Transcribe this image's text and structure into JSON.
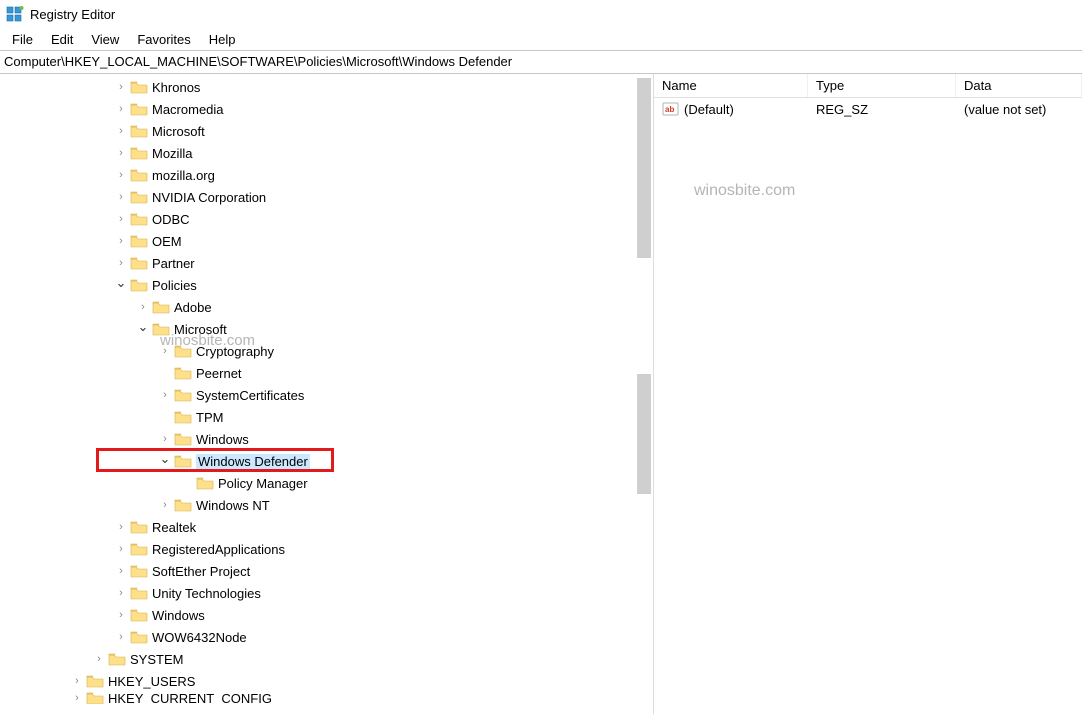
{
  "window": {
    "title": "Registry Editor"
  },
  "menu": {
    "items": [
      "File",
      "Edit",
      "View",
      "Favorites",
      "Help"
    ]
  },
  "address": {
    "path": "Computer\\HKEY_LOCAL_MACHINE\\SOFTWARE\\Policies\\Microsoft\\Windows Defender"
  },
  "list": {
    "columns": [
      "Name",
      "Type",
      "Data"
    ],
    "rows": [
      {
        "name": "(Default)",
        "type": "REG_SZ",
        "data": "(value not set)"
      }
    ]
  },
  "watermark": {
    "text": "winosbite.com"
  },
  "tree": [
    {
      "d": 3,
      "chev": "r",
      "label": "Khronos"
    },
    {
      "d": 3,
      "chev": "r",
      "label": "Macromedia"
    },
    {
      "d": 3,
      "chev": "r",
      "label": "Microsoft"
    },
    {
      "d": 3,
      "chev": "r",
      "label": "Mozilla"
    },
    {
      "d": 3,
      "chev": "r",
      "label": "mozilla.org"
    },
    {
      "d": 3,
      "chev": "r",
      "label": "NVIDIA Corporation"
    },
    {
      "d": 3,
      "chev": "r",
      "label": "ODBC"
    },
    {
      "d": 3,
      "chev": "r",
      "label": "OEM"
    },
    {
      "d": 3,
      "chev": "r",
      "label": "Partner"
    },
    {
      "d": 3,
      "chev": "d",
      "label": "Policies"
    },
    {
      "d": 4,
      "chev": "r",
      "label": "Adobe"
    },
    {
      "d": 4,
      "chev": "d",
      "label": "Microsoft"
    },
    {
      "d": 5,
      "chev": "r",
      "label": "Cryptography"
    },
    {
      "d": 5,
      "chev": "",
      "label": "Peernet"
    },
    {
      "d": 5,
      "chev": "r",
      "label": "SystemCertificates"
    },
    {
      "d": 5,
      "chev": "",
      "label": "TPM"
    },
    {
      "d": 5,
      "chev": "r",
      "label": "Windows"
    },
    {
      "d": 5,
      "chev": "d",
      "label": "Windows Defender",
      "selected": true
    },
    {
      "d": 6,
      "chev": "",
      "label": "Policy Manager"
    },
    {
      "d": 5,
      "chev": "r",
      "label": "Windows NT"
    },
    {
      "d": 3,
      "chev": "r",
      "label": "Realtek"
    },
    {
      "d": 3,
      "chev": "r",
      "label": "RegisteredApplications"
    },
    {
      "d": 3,
      "chev": "r",
      "label": "SoftEther Project"
    },
    {
      "d": 3,
      "chev": "r",
      "label": "Unity Technologies"
    },
    {
      "d": 3,
      "chev": "r",
      "label": "Windows"
    },
    {
      "d": 3,
      "chev": "r",
      "label": "WOW6432Node"
    },
    {
      "d": 2,
      "chev": "r",
      "label": "SYSTEM"
    },
    {
      "d": 1,
      "chev": "r",
      "label": "HKEY_USERS"
    },
    {
      "d": 1,
      "chev": "r",
      "label": "HKEY_CURRENT_CONFIG",
      "cut": true
    }
  ]
}
